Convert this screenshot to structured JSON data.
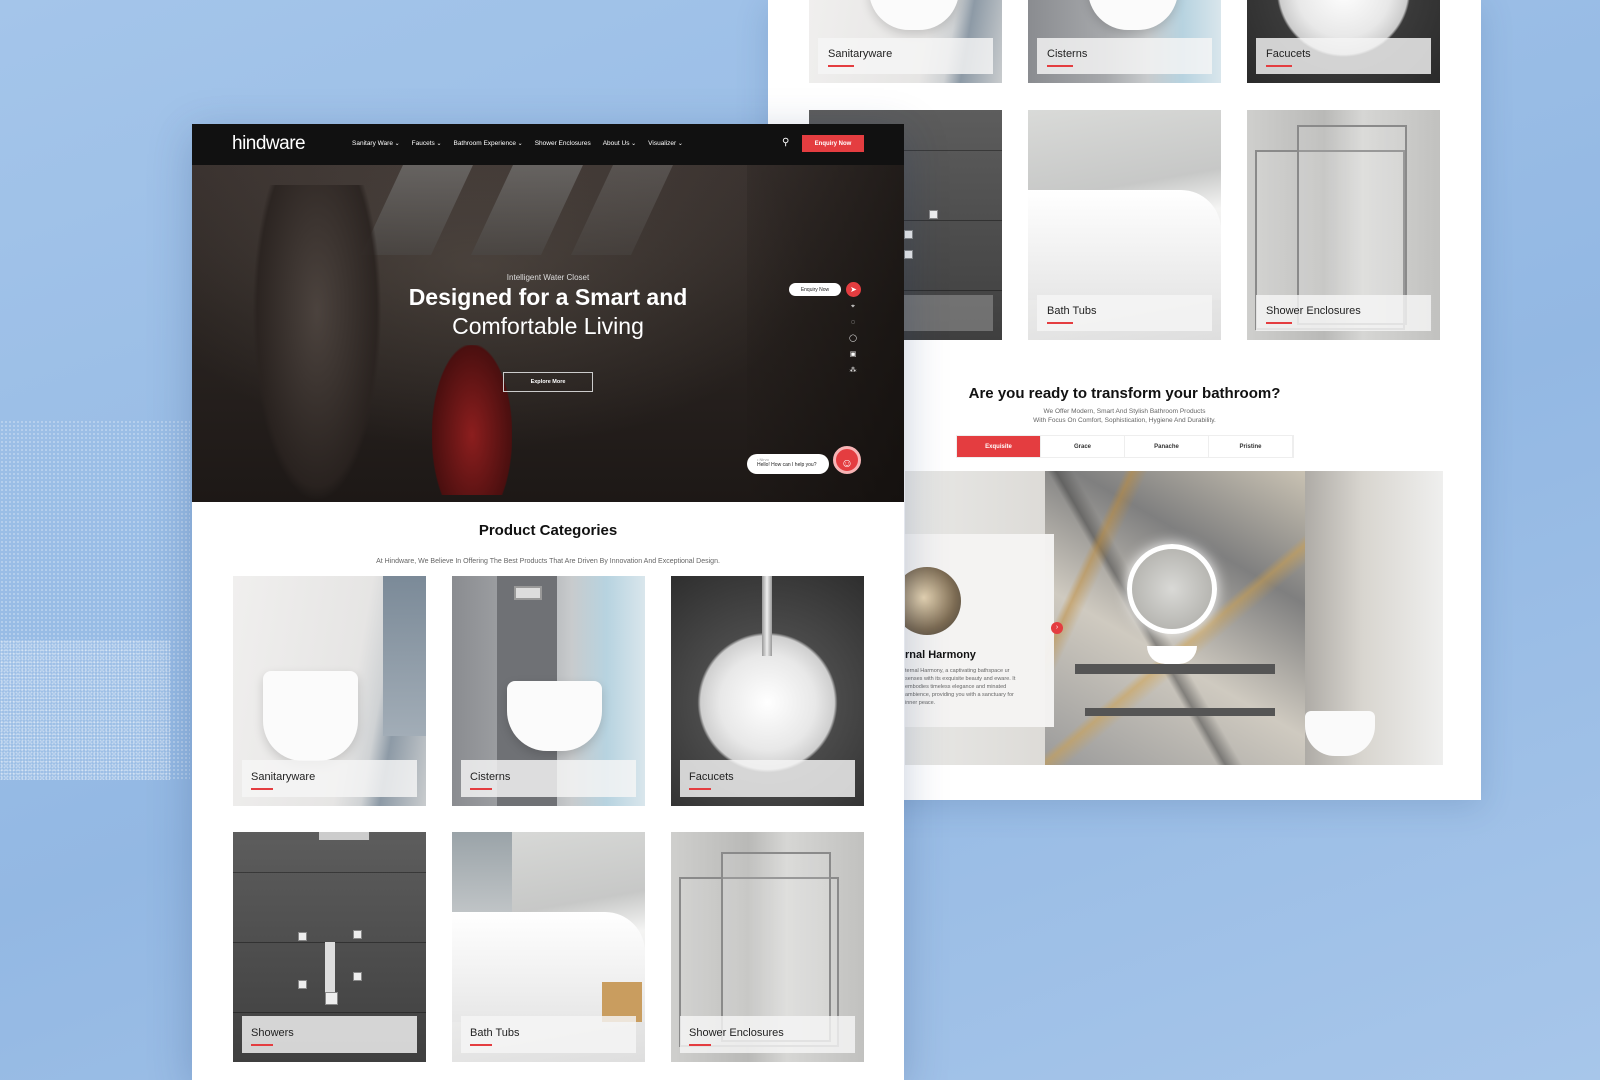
{
  "brand": {
    "logo": "hindware",
    "accent": "#e43d40",
    "background": "#9cbfe6"
  },
  "nav": {
    "items": [
      "Sanitary Ware",
      "Faucets",
      "Bathroom Experience",
      "Shower Enclosures",
      "About Us",
      "Visualizer"
    ],
    "enquiry_label": "Enquiry Now",
    "search_icon": "search-icon"
  },
  "hero": {
    "kicker": "Intelligent Water Closet",
    "headline_bold": "Designed for a Smart and",
    "headline_light": "Comfortable Living",
    "cta": "Explore More",
    "floating_enquiry": "Enquiry Now",
    "side_icons": [
      "location-icon",
      "chat-icon",
      "whatsapp-icon",
      "catalog-icon",
      "network-icon"
    ],
    "chat": {
      "name": "• Nirvo",
      "message": "Hello! How can I help you?"
    }
  },
  "categories": {
    "title": "Product Categories",
    "subtitle": "At Hindware, We Believe In Offering The Best Products That Are Driven By Innovation And Exceptional Design.",
    "items": [
      "Sanitaryware",
      "Cisterns",
      "Facucets",
      "Showers",
      "Bath Tubs",
      "Shower Enclosures"
    ]
  },
  "back_page": {
    "cards": [
      "Sanitaryware",
      "Cisterns",
      "Facucets",
      "Bath Tubs",
      "Shower Enclosures"
    ],
    "transform_title": "Are you ready to transform your bathroom?",
    "transform_sub_1": "We Offer Modern, Smart And Stylish Bathroom Products",
    "transform_sub_2": "With Focus On Comfort, Sophistication, Hygiene And Durability.",
    "tabs": [
      "Exquisite",
      "Grace",
      "Panache",
      "Pristine"
    ],
    "active_tab": "Exquisite",
    "collection": {
      "title": "rnal Harmony",
      "text": "ternal Harmony, a captivating bathspace ur senses with its exquisite beauty and ewarе. It embodies timeless elegance and minated ambience, providing you with a sanctuary for inner peace."
    }
  }
}
